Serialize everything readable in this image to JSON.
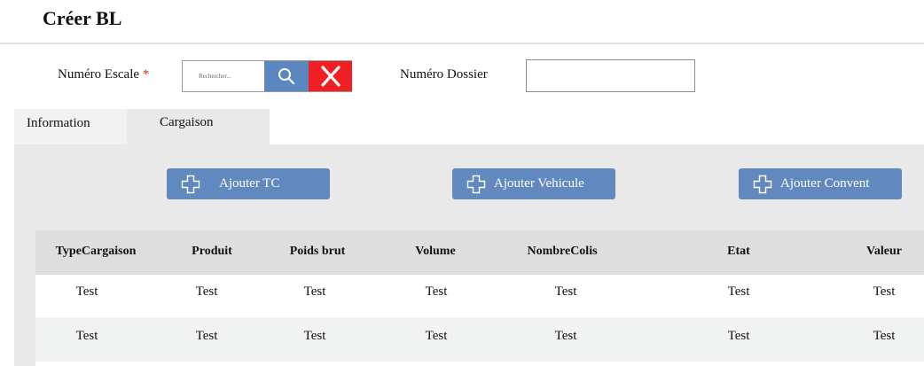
{
  "page": {
    "title": "Créer BL"
  },
  "form": {
    "escale_label": "Numéro Escale",
    "required_mark": "*",
    "escale_placeholder": "Rechercher...",
    "dossier_label": "Numéro Dossier",
    "dossier_value": ""
  },
  "tabs": [
    {
      "label": "Information",
      "active": false
    },
    {
      "label": "Cargaison",
      "active": true
    }
  ],
  "actions": {
    "add_tc": "Ajouter TC",
    "add_vehicle": "Ajouter Vehicule",
    "add_convent": "Ajouter Convent"
  },
  "table": {
    "columns": [
      "TypeCargaison",
      "Produit",
      "Poids brut",
      "Volume",
      "NombreColis",
      "Etat",
      "Valeur"
    ],
    "rows": [
      [
        "Test",
        "Test",
        "Test",
        "Test",
        "Test",
        "Test",
        "Test"
      ],
      [
        "Test",
        "Test",
        "Test",
        "Test",
        "Test",
        "Test",
        "Test"
      ]
    ]
  },
  "colors": {
    "primary_button": "#6189bf",
    "search_button": "#5b86c0",
    "clear_button": "#f01f24",
    "required": "#e32b2b",
    "panel": "#e9e9e9"
  },
  "icons": {
    "search": "search-icon",
    "clear": "close-icon",
    "add": "plus-outline-icon"
  }
}
